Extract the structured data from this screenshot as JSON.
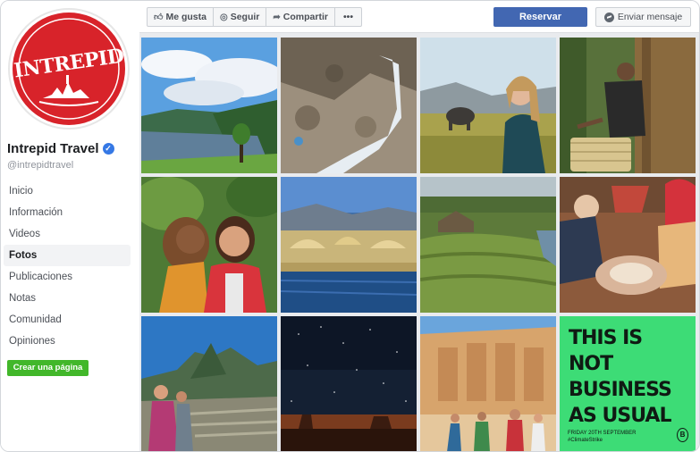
{
  "page": {
    "logo_text": "INTREPID",
    "name": "Intrepid Travel",
    "verified_icon": "verified-check-icon",
    "handle": "@intrepidtravel"
  },
  "nav": {
    "items": [
      {
        "label": "Inicio",
        "active": false
      },
      {
        "label": "Información",
        "active": false
      },
      {
        "label": "Videos",
        "active": false
      },
      {
        "label": "Fotos",
        "active": true
      },
      {
        "label": "Publicaciones",
        "active": false
      },
      {
        "label": "Notas",
        "active": false
      },
      {
        "label": "Comunidad",
        "active": false
      },
      {
        "label": "Opiniones",
        "active": false
      }
    ],
    "create_page_label": "Crear una página"
  },
  "toolbar": {
    "like_label": "Me gusta",
    "follow_label": "Seguir",
    "share_label": "Compartir",
    "more_label": "•••",
    "reserve_label": "Reservar",
    "message_label": "Enviar mensaje"
  },
  "photos": [
    {
      "alt": "lake-landscape"
    },
    {
      "alt": "rocky-waterfall"
    },
    {
      "alt": "woman-with-elephant"
    },
    {
      "alt": "man-with-basket"
    },
    {
      "alt": "selfie-couple"
    },
    {
      "alt": "reed-village-lake"
    },
    {
      "alt": "wetland-aerial"
    },
    {
      "alt": "cooking-women"
    },
    {
      "alt": "machu-picchu"
    },
    {
      "alt": "night-sky-desert"
    },
    {
      "alt": "abu-simbel-group"
    },
    {
      "alt": "climate-poster"
    }
  ],
  "poster": {
    "headline_lines": [
      "THIS IS NOT",
      "BUSINESS",
      "AS USUAL"
    ],
    "date_line": "FRIDAY 20TH SEPTEMBER",
    "hashtag": "#ClimateStrike",
    "badge": "B"
  },
  "colors": {
    "accent": "#4267b2",
    "green": "#42b72a",
    "logo_red": "#d8232a",
    "poster_green": "#3ddc76"
  }
}
